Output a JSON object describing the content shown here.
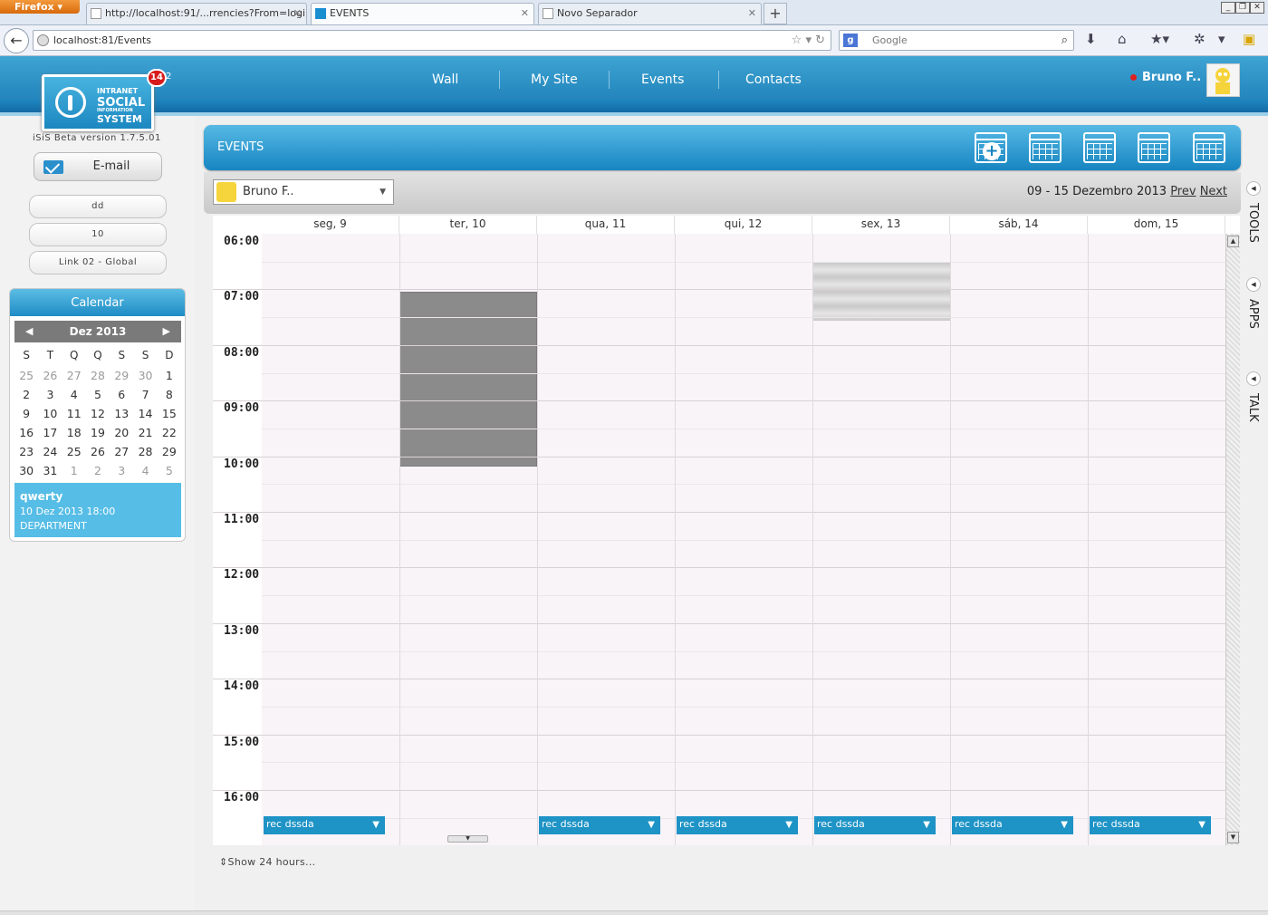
{
  "browser": {
    "menu_label": "Firefox",
    "tabs": [
      {
        "title": "http://localhost:91/...rrencies?From=login"
      },
      {
        "title": "EVENTS"
      },
      {
        "title": "Novo Separador"
      }
    ],
    "url": "localhost:81/Events",
    "search_placeholder": "Google"
  },
  "app": {
    "logo_lines": [
      "INTRANET",
      "SOCIAL",
      "INFORMATION",
      "SYSTEM"
    ],
    "notification_count": "14",
    "notification_extra": "2",
    "version": "iSiS Beta version 1.7.5.01",
    "nav": [
      "Wall",
      "My Site",
      "Events",
      "Contacts"
    ],
    "user_name": "Bruno F.."
  },
  "sidebar": {
    "email_label": "E-mail",
    "buttons": [
      "dd",
      "10",
      "Link 02 - Global"
    ],
    "calendar": {
      "title": "Calendar",
      "month": "Dez 2013",
      "weekdays": [
        "S",
        "T",
        "Q",
        "Q",
        "S",
        "S",
        "D"
      ],
      "rows": [
        [
          [
            "25",
            1
          ],
          [
            "26",
            1
          ],
          [
            "27",
            1
          ],
          [
            "28",
            1
          ],
          [
            "29",
            1
          ],
          [
            "30",
            1
          ],
          [
            "1",
            0
          ]
        ],
        [
          [
            "2",
            0
          ],
          [
            "3",
            0
          ],
          [
            "4",
            0
          ],
          [
            "5",
            0
          ],
          [
            "6",
            0
          ],
          [
            "7",
            0
          ],
          [
            "8",
            0
          ]
        ],
        [
          [
            "9",
            0
          ],
          [
            "10",
            0
          ],
          [
            "11",
            0
          ],
          [
            "12",
            0
          ],
          [
            "13",
            0
          ],
          [
            "14",
            0
          ],
          [
            "15",
            0
          ]
        ],
        [
          [
            "16",
            0
          ],
          [
            "17",
            0
          ],
          [
            "18",
            0
          ],
          [
            "19",
            0
          ],
          [
            "20",
            0
          ],
          [
            "21",
            0
          ],
          [
            "22",
            0
          ]
        ],
        [
          [
            "23",
            0
          ],
          [
            "24",
            0
          ],
          [
            "25",
            0
          ],
          [
            "26",
            0
          ],
          [
            "27",
            0
          ],
          [
            "28",
            0
          ],
          [
            "29",
            0
          ]
        ],
        [
          [
            "30",
            0
          ],
          [
            "31",
            0
          ],
          [
            "1",
            1
          ],
          [
            "2",
            1
          ],
          [
            "3",
            1
          ],
          [
            "4",
            1
          ],
          [
            "5",
            1
          ]
        ]
      ],
      "event": {
        "title": "qwerty",
        "datetime": "10 Dez 2013 18:00",
        "category": "DEPARTMENT"
      }
    }
  },
  "events": {
    "title": "EVENTS",
    "selected_user": "Bruno F..",
    "date_range": "09 - 15 Dezembro 2013",
    "prev_label": "Prev",
    "next_label": "Next",
    "days": [
      "seg, 9",
      "ter, 10",
      "qua, 11",
      "qui, 12",
      "sex, 13",
      "sáb, 14",
      "dom, 15"
    ],
    "hours": [
      "06:00",
      "07:00",
      "08:00",
      "09:00",
      "10:00",
      "11:00",
      "12:00",
      "13:00",
      "14:00",
      "15:00",
      "16:00"
    ],
    "recurring_label": "rec dssda",
    "recurring_days": [
      0,
      2,
      3,
      4,
      5,
      6
    ],
    "show24_label": "Show 24 hours..."
  },
  "side_tabs": [
    "TOOLS",
    "APPS",
    "TALK"
  ],
  "colors": {
    "accent": "#1e93c6",
    "header": "#1b7cb5",
    "event_block": "#8c8b8c",
    "badge": "#d81a1a"
  }
}
